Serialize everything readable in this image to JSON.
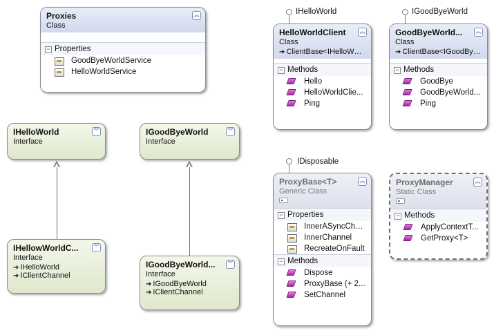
{
  "shapes": {
    "proxies": {
      "title": "Proxies",
      "stereotype": "Class",
      "sections": [
        {
          "title": "Properties",
          "members": [
            "GoodByeWorldService",
            "HelloWorldService"
          ]
        }
      ]
    },
    "hello_client": {
      "title": "HelloWorldClient",
      "stereotype": "Class",
      "base": "ClientBase<IHelloWor...",
      "lollipop": "IHelloWorld",
      "sections": [
        {
          "title": "Methods",
          "members": [
            "Hello",
            "HelloWorldClie...",
            "Ping"
          ]
        }
      ]
    },
    "goodbye_client": {
      "title": "GoodByeWorld...",
      "stereotype": "Class",
      "base": "ClientBase<IGoodBye...",
      "lollipop": "IGoodByeWorld",
      "sections": [
        {
          "title": "Methods",
          "members": [
            "GoodBye",
            "GoodByeWorld...",
            "Ping"
          ]
        }
      ]
    },
    "ihelloworld": {
      "title": "IHelloWorld",
      "stereotype": "Interface"
    },
    "igoodbyeworld": {
      "title": "IGoodByeWorld",
      "stereotype": "Interface"
    },
    "ihellow_channel": {
      "title": "IHellowWorldC...",
      "stereotype": "Interface",
      "bases": [
        "IHelloWorld",
        "IClientChannel"
      ]
    },
    "igoodbye_channel": {
      "title": "IGoodByeWorld...",
      "stereotype": "Interface",
      "bases": [
        "IGoodByeWorld",
        "IClientChannel"
      ]
    },
    "proxybase": {
      "title": "ProxyBase<T>",
      "stereotype": "Generic Class",
      "lollipop": "IDisposable",
      "sections": [
        {
          "title": "Properties",
          "members": [
            "InnerASyncCha...",
            "InnerChannel",
            "RecreateOnFault"
          ]
        },
        {
          "title": "Methods",
          "members": [
            "Dispose",
            "ProxyBase (+ 2...",
            "SetChannel"
          ]
        }
      ]
    },
    "proxymanager": {
      "title": "ProxyManager",
      "stereotype": "Static Class",
      "sections": [
        {
          "title": "Methods",
          "members": [
            "ApplyContextT...",
            "GetProxy<T>"
          ]
        }
      ]
    }
  },
  "icons": {
    "collapse": "chevron-up-icon",
    "expand": "chevron-down-icon",
    "method": "method-icon",
    "property": "property-icon",
    "base_arrow": "inheritance-arrow-icon"
  }
}
